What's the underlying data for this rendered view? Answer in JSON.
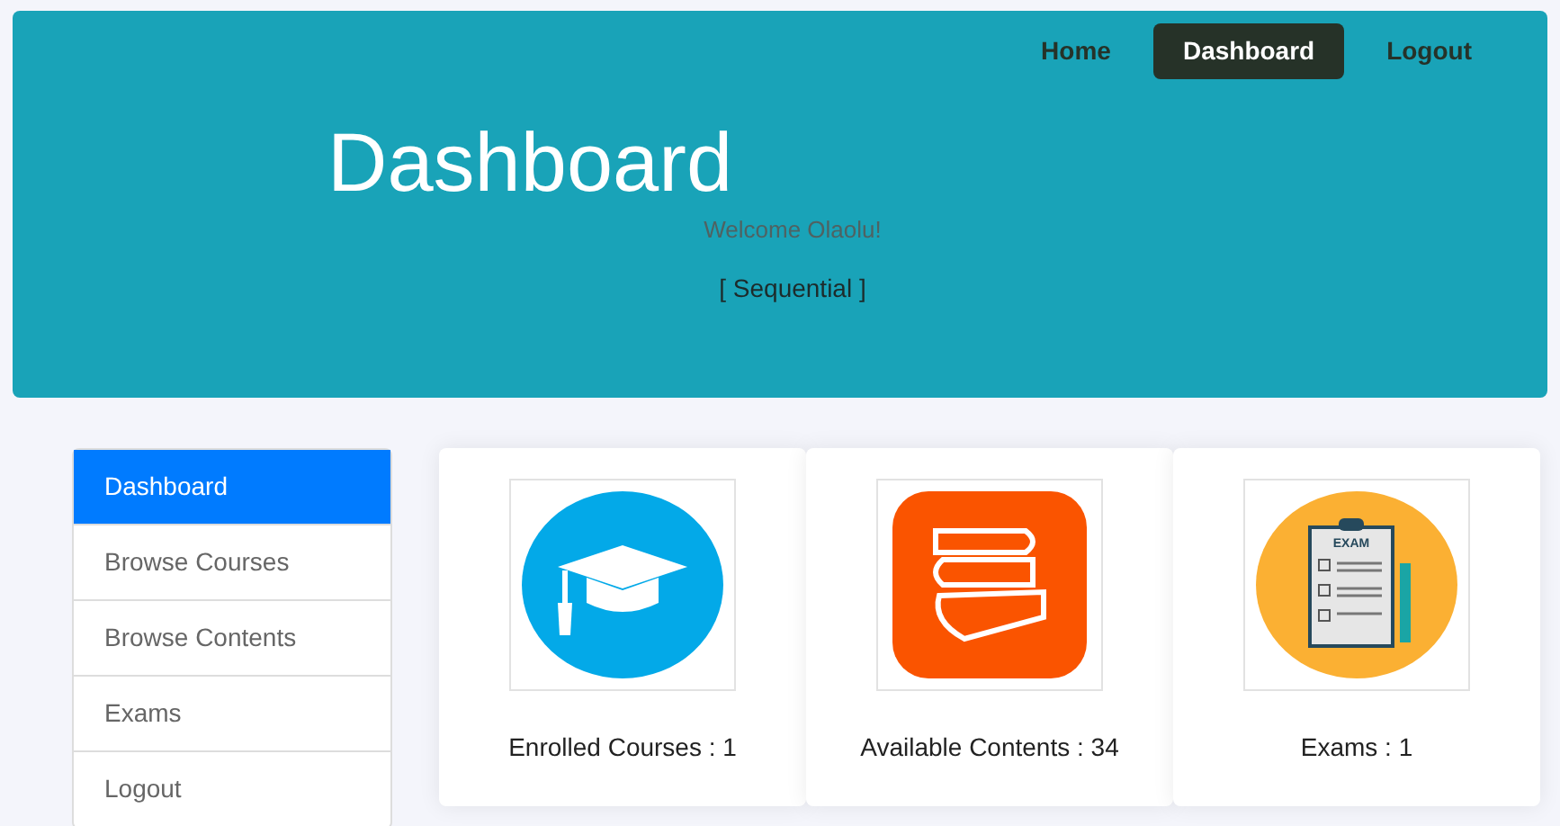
{
  "nav": [
    {
      "label": "Home",
      "selected": false
    },
    {
      "label": "Dashboard",
      "selected": true
    },
    {
      "label": "Logout",
      "selected": false
    }
  ],
  "header": {
    "title": "Dashboard",
    "welcome": "Welcome Olaolu!",
    "mode": "[ Sequential ]"
  },
  "sidebar": {
    "items": [
      {
        "label": "Dashboard",
        "selected": true
      },
      {
        "label": "Browse Courses",
        "selected": false
      },
      {
        "label": "Browse Contents",
        "selected": false
      },
      {
        "label": "Exams",
        "selected": false
      },
      {
        "label": "Logout",
        "selected": false
      }
    ]
  },
  "cards": [
    {
      "kind": "cap",
      "label": "Enrolled Courses : 1"
    },
    {
      "kind": "books",
      "label": "Available Contents : 34"
    },
    {
      "kind": "exam",
      "label": "Exams : 1",
      "icon_text": "EXAM"
    }
  ]
}
